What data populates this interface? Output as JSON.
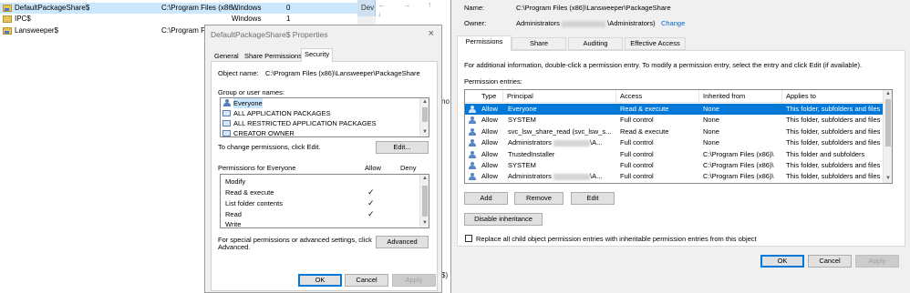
{
  "shares_list": {
    "rows": [
      {
        "name": "DefaultPackageShare$",
        "path": "C:\\Program Files (x86...",
        "type": "Windows",
        "count": "0",
        "selected": true
      },
      {
        "name": "IPC$",
        "path": "",
        "type": "Windows",
        "count": "1",
        "selected": false
      },
      {
        "name": "Lansweeper$",
        "path": "C:\\Program Fil...",
        "type": "",
        "count": "",
        "selected": false
      }
    ],
    "strip_label": "Dev",
    "peek_text_1": "no",
    "peek_text_2": "$)"
  },
  "properties": {
    "title": "DefaultPackageShare$ Properties",
    "close_glyph": "×",
    "tabs": [
      "General",
      "Share Permissions",
      "Security"
    ],
    "active_tab": "Security",
    "object_name_label": "Object name:",
    "object_name_value": "C:\\Program Files (x86)\\Lansweeper\\PackageShare",
    "groups_label": "Group or user names:",
    "groups": [
      {
        "name": "Everyone",
        "icon": "users-icon"
      },
      {
        "name": "ALL APPLICATION PACKAGES",
        "icon": "group-icon"
      },
      {
        "name": "ALL RESTRICTED APPLICATION PACKAGES",
        "icon": "group-icon"
      },
      {
        "name": "CREATOR OWNER",
        "icon": "group-icon"
      }
    ],
    "change_hint": "To change permissions, click Edit.",
    "edit_button": "Edit...",
    "permissions_for": "Permissions for Everyone",
    "allow_header": "Allow",
    "deny_header": "Deny",
    "permissions": [
      {
        "name": "Modify",
        "allow": false,
        "deny": false
      },
      {
        "name": "Read & execute",
        "allow": true,
        "deny": false
      },
      {
        "name": "List folder contents",
        "allow": true,
        "deny": false
      },
      {
        "name": "Read",
        "allow": true,
        "deny": false
      },
      {
        "name": "Write",
        "allow": false,
        "deny": false
      }
    ],
    "check_glyph": "✓",
    "special_hint_line1": "For special permissions or advanced settings, click",
    "special_hint_line2": "Advanced.",
    "advanced_button": "Advanced",
    "ok_button": "OK",
    "cancel_button": "Cancel",
    "apply_button": "Apply"
  },
  "advanced": {
    "name_label": "Name:",
    "name_value": "C:\\Program Files (x86)\\Lansweeper\\PackageShare",
    "owner_label": "Owner:",
    "owner_prefix": "Administrators",
    "owner_suffix": "\\Administrators)",
    "change_link": "Change",
    "tabs": [
      "Permissions",
      "Share",
      "Auditing",
      "Effective Access"
    ],
    "active_tab": "Permissions",
    "info_text": "For additional information, double-click a permission entry. To modify a permission entry, select the entry and click Edit (if available).",
    "entries_label": "Permission entries:",
    "columns": [
      "Type",
      "Principal",
      "Access",
      "Inherited from",
      "Applies to"
    ],
    "entries": [
      {
        "type": "Allow",
        "principal": "Everyone",
        "blurred": false,
        "principal_suffix": "",
        "access": "Read & execute",
        "inherited": "None",
        "applies": "This folder, subfolders and files",
        "selected": true
      },
      {
        "type": "Allow",
        "principal": "SYSTEM",
        "blurred": false,
        "principal_suffix": "",
        "access": "Full control",
        "inherited": "None",
        "applies": "This folder, subfolders and files",
        "selected": false
      },
      {
        "type": "Allow",
        "principal": "svc_lsw_share_read (svc_lsw_s...",
        "blurred": false,
        "principal_suffix": "",
        "access": "Read & execute",
        "inherited": "None",
        "applies": "This folder, subfolders and files",
        "selected": false
      },
      {
        "type": "Allow",
        "principal": "Administrators",
        "blurred": true,
        "principal_suffix": "\\A...",
        "access": "Full control",
        "inherited": "None",
        "applies": "This folder, subfolders and files",
        "selected": false
      },
      {
        "type": "Allow",
        "principal": "TrustedInstaller",
        "blurred": false,
        "principal_suffix": "",
        "access": "Full control",
        "inherited": "C:\\Program Files (x86)\\",
        "applies": "This folder and subfolders",
        "selected": false
      },
      {
        "type": "Allow",
        "principal": "SYSTEM",
        "blurred": false,
        "principal_suffix": "",
        "access": "Full control",
        "inherited": "C:\\Program Files (x86)\\",
        "applies": "This folder, subfolders and files",
        "selected": false
      },
      {
        "type": "Allow",
        "principal": "Administrators",
        "blurred": true,
        "principal_suffix": "\\A...",
        "access": "Full control",
        "inherited": "C:\\Program Files (x86)\\",
        "applies": "This folder, subfolders and files",
        "selected": false
      }
    ],
    "add_button": "Add",
    "remove_button": "Remove",
    "edit_button": "Edit",
    "disable_inheritance_button": "Disable inheritance",
    "replace_checkbox_label": "Replace all child object permission entries with inheritable permission entries from this object",
    "replace_checked": false,
    "ok_button": "OK",
    "cancel_button": "Cancel",
    "apply_button": "Apply"
  },
  "colors": {
    "selection_blue": "#0078d7",
    "light_selection": "#cce8ff",
    "link_blue": "#0066cc",
    "dialog_gray": "#f0f0f0"
  }
}
